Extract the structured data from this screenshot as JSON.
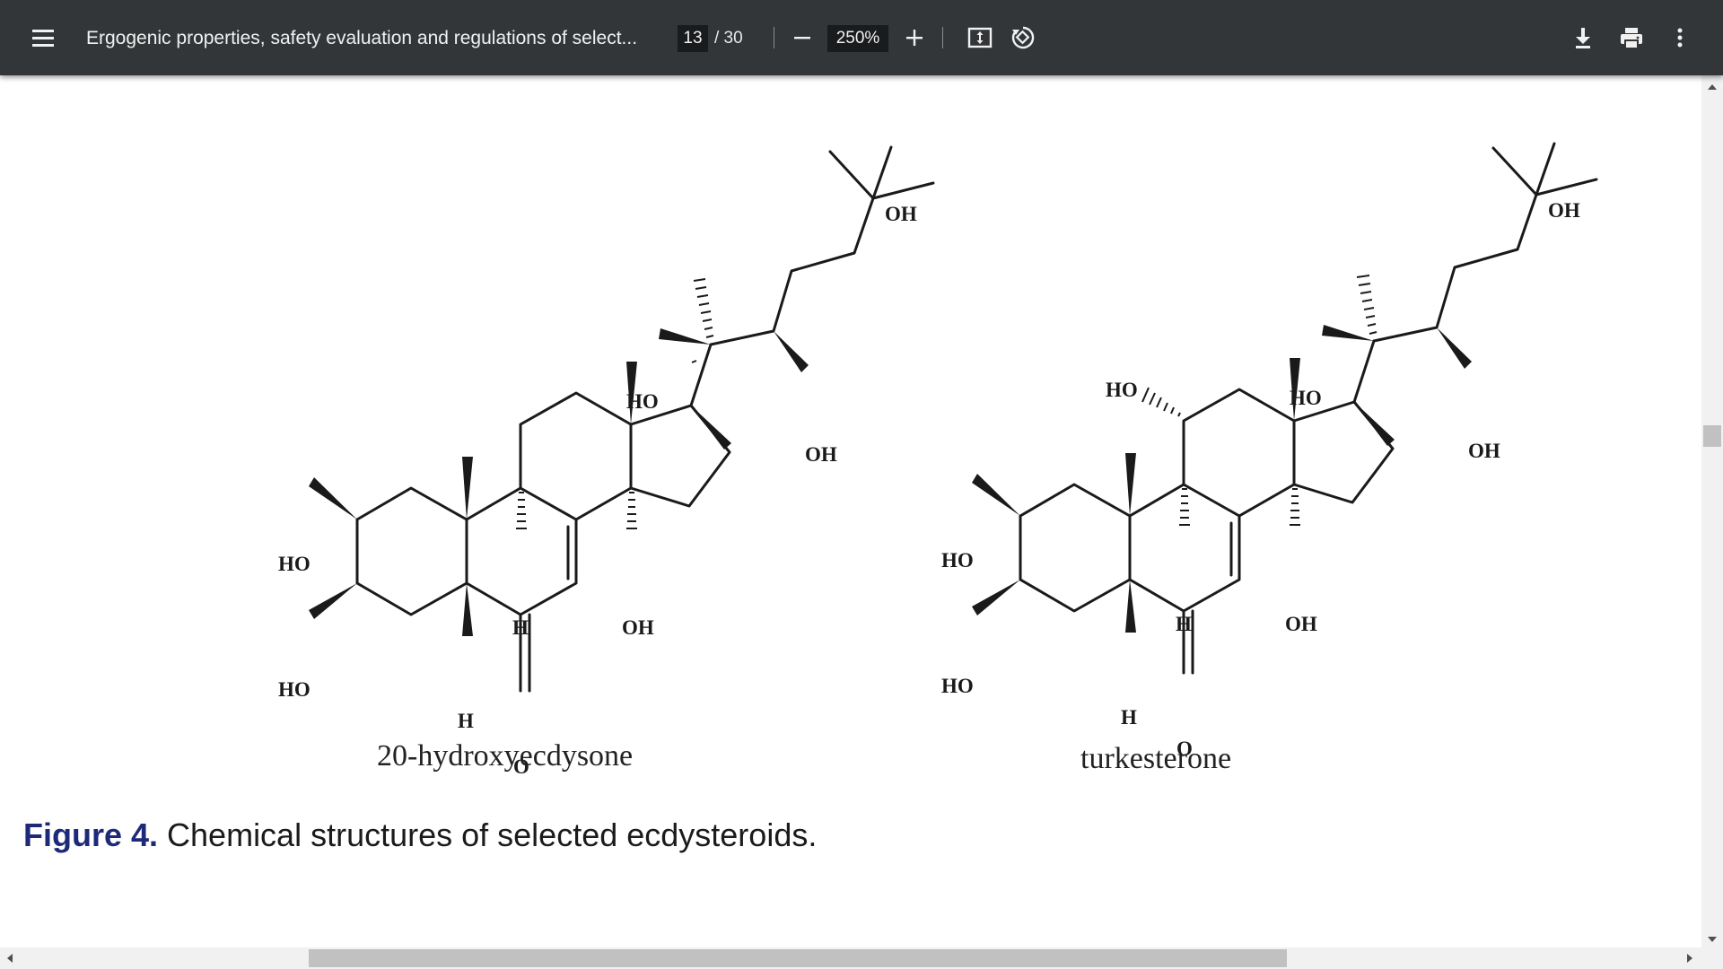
{
  "toolbar": {
    "menu_icon": "hamburger-menu-icon",
    "title": "Ergogenic properties, safety evaluation and regulations of select...",
    "page_current": "13",
    "page_total": "/  30",
    "zoom_value": "250%",
    "zoom_out_icon": "minus-icon",
    "zoom_in_icon": "plus-icon",
    "fit_icon": "fit-to-page-icon",
    "rotate_icon": "rotate-icon",
    "download_icon": "download-icon",
    "print_icon": "print-icon",
    "more_icon": "more-vert-icon",
    "background": "#323639"
  },
  "figure": {
    "compound_left": {
      "name": "20-hydroxyecdysone",
      "labels": {
        "oh_top": "OH",
        "ho_c20": "HO",
        "oh_c22": "OH",
        "ho_c2": "HO",
        "ho_c3": "HO",
        "h_c9": "H",
        "h_c5": "H",
        "oh_c14": "OH",
        "o_c6": "O"
      }
    },
    "compound_right": {
      "name": "turkesterone",
      "labels": {
        "oh_top": "OH",
        "ho_c20": "HO",
        "oh_c22": "OH",
        "ho_c11": "HO",
        "ho_c2": "HO",
        "ho_c3": "HO",
        "h_c9": "H",
        "h_c5": "H",
        "oh_c14": "OH",
        "o_c6": "O"
      }
    },
    "caption_label": "Figure 4.",
    "caption_text": " Chemical structures of selected ecdysteroids.",
    "caption_label_color": "#1e2a78"
  },
  "scrollbars": {
    "vertical_icon_up": "scroll-up-arrow-icon",
    "vertical_icon_down": "scroll-down-arrow-icon",
    "horizontal_icon_left": "scroll-left-arrow-icon",
    "horizontal_icon_right": "scroll-right-arrow-icon"
  }
}
